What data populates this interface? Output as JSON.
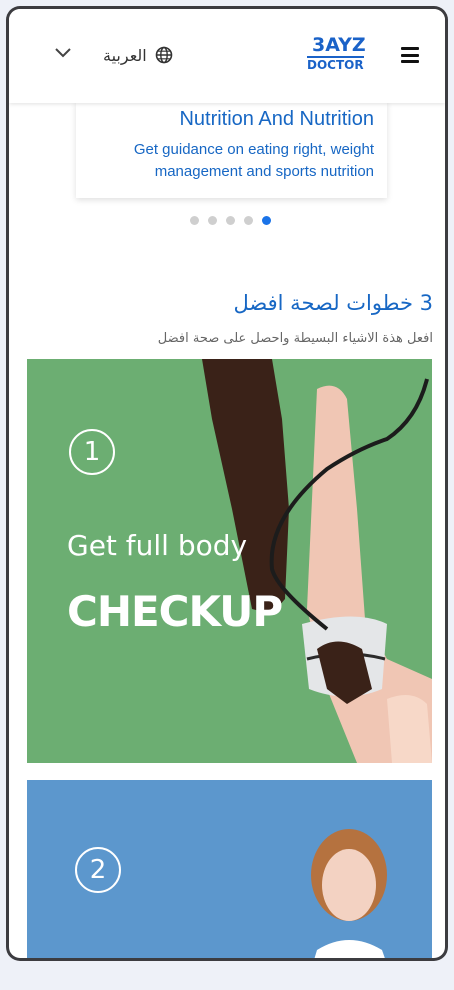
{
  "header": {
    "language_label": "العربية",
    "logo_top": "3AYZ",
    "logo_bottom": "DOCTOR"
  },
  "carousel": {
    "card_title": "Nutrition And Nutrition",
    "card_description": "Get guidance on eating right, weight management and sports nutrition",
    "dot_count": 5,
    "active_index": 4
  },
  "steps_section": {
    "title": "3 خطوات لصحة افضل",
    "subtitle": "افعل هذة الاشياء البسيطة واحصل على صحة افضل",
    "step1": {
      "number": "1",
      "line1": "Get full body",
      "line2": "CHECKUP"
    },
    "step2": {
      "number": "2"
    }
  },
  "colors": {
    "accent": "#1767c4",
    "step1_bg": "#6cae72",
    "step2_bg": "#5c97cd",
    "active_dot": "#1a73e8"
  }
}
